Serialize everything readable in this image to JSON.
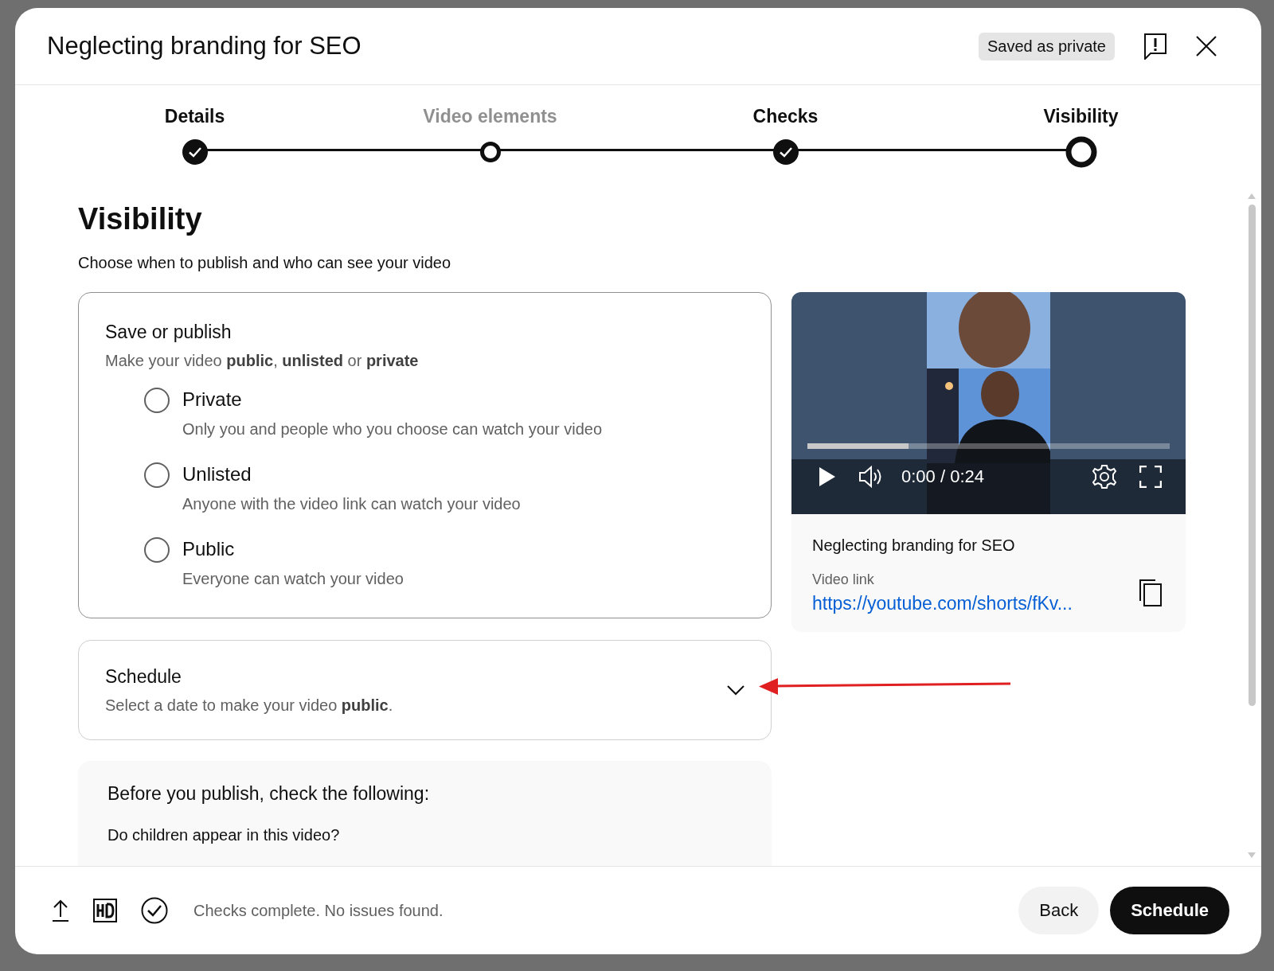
{
  "dialog": {
    "title": "Neglecting branding for SEO",
    "status_badge": "Saved as private"
  },
  "steps": [
    {
      "label": "Details",
      "done": true,
      "selected": false
    },
    {
      "label": "Video elements",
      "done": false,
      "selected": false
    },
    {
      "label": "Checks",
      "done": true,
      "selected": false
    },
    {
      "label": "Visibility",
      "done": false,
      "selected": true
    }
  ],
  "visibility": {
    "heading": "Visibility",
    "subtitle": "Choose when to publish and who can see your video"
  },
  "save_or_publish": {
    "title": "Save or publish",
    "subtitle": "Make your video **public**, **unlisted** or **private**",
    "options": [
      {
        "label": "Private",
        "description": "Only you and people who you choose can watch your video",
        "selected": false
      },
      {
        "label": "Unlisted",
        "description": "Anyone with the video link can watch your video",
        "selected": false
      },
      {
        "label": "Public",
        "description": "Everyone can watch your video",
        "selected": false
      }
    ]
  },
  "schedule": {
    "title": "Schedule",
    "subtitle": "Select a date to make your video **public**.",
    "expanded": false
  },
  "checklist": {
    "title": "Before you publish, check the following:",
    "question": "Do children appear in this video?"
  },
  "video": {
    "kind": "picture",
    "time": "0:00 / 0:24",
    "level": 0.28,
    "title": "Neglecting branding for SEO",
    "link_label": "Video link",
    "link": "https://youtube.com/shorts/fKv..."
  },
  "footer": {
    "status": "Checks complete. No issues found.",
    "buttons": [
      {
        "label": "Back",
        "kind": "secondary"
      },
      {
        "label": "Schedule",
        "kind": "primary"
      }
    ]
  }
}
